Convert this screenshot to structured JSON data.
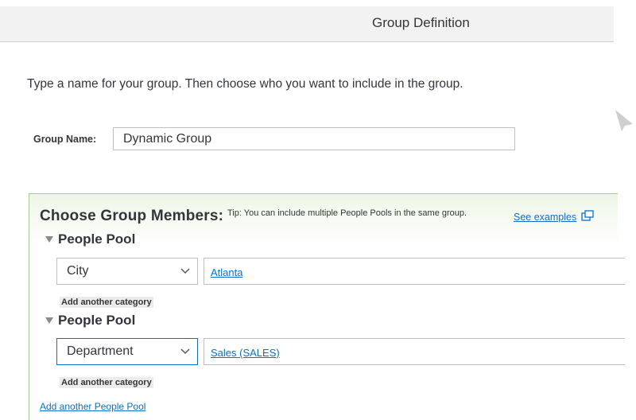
{
  "header": {
    "title": "Group Definition"
  },
  "instruction": "Type a name for your group. Then choose who you want to include in the group.",
  "group_name": {
    "label": "Group Name:",
    "value": "Dynamic Group"
  },
  "members": {
    "title": "Choose Group Members:",
    "tip": "Tip: You can include multiple People Pools in the same group.",
    "see_examples": "See examples",
    "pools": [
      {
        "title": "People Pool",
        "category": "City",
        "value": "Atlanta",
        "add_category": "Add another category"
      },
      {
        "title": "People Pool",
        "category": "Department",
        "value": "Sales (SALES)",
        "add_category": "Add another category"
      }
    ],
    "add_pool": "Add another People Pool"
  },
  "colors": {
    "link": "#0a6ed1",
    "panel_border": "#aac796",
    "panel_tint": "#eef6e6"
  }
}
